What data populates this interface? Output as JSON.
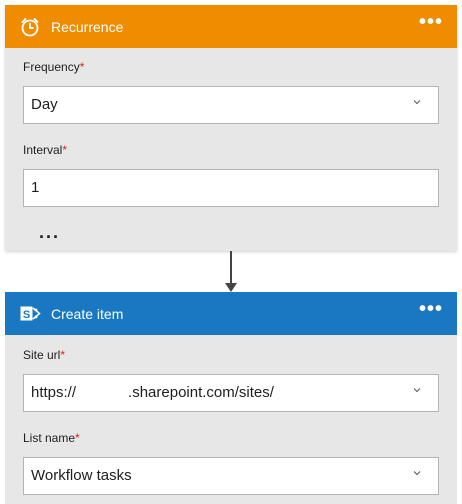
{
  "recurrence_card": {
    "title": "Recurrence",
    "more_label": "•••",
    "icon": "alarm-clock-icon",
    "header_color": "#f08c00",
    "frequency": {
      "label": "Frequency",
      "required_mark": "*",
      "value": "Day"
    },
    "interval": {
      "label": "Interval",
      "required_mark": "*",
      "value": "1"
    },
    "show_more_label": "..."
  },
  "create_item_card": {
    "title": "Create item",
    "more_label": "•••",
    "icon": "sharepoint-icon",
    "header_color": "#1a78c2",
    "site_url": {
      "label": "Site url",
      "required_mark": "*",
      "value_prefix": "https://",
      "value_suffix": ".sharepoint.com/sites/"
    },
    "list_name": {
      "label": "List name",
      "required_mark": "*",
      "value": "Workflow tasks"
    }
  },
  "connector": {
    "icon": "down-arrow-icon"
  }
}
